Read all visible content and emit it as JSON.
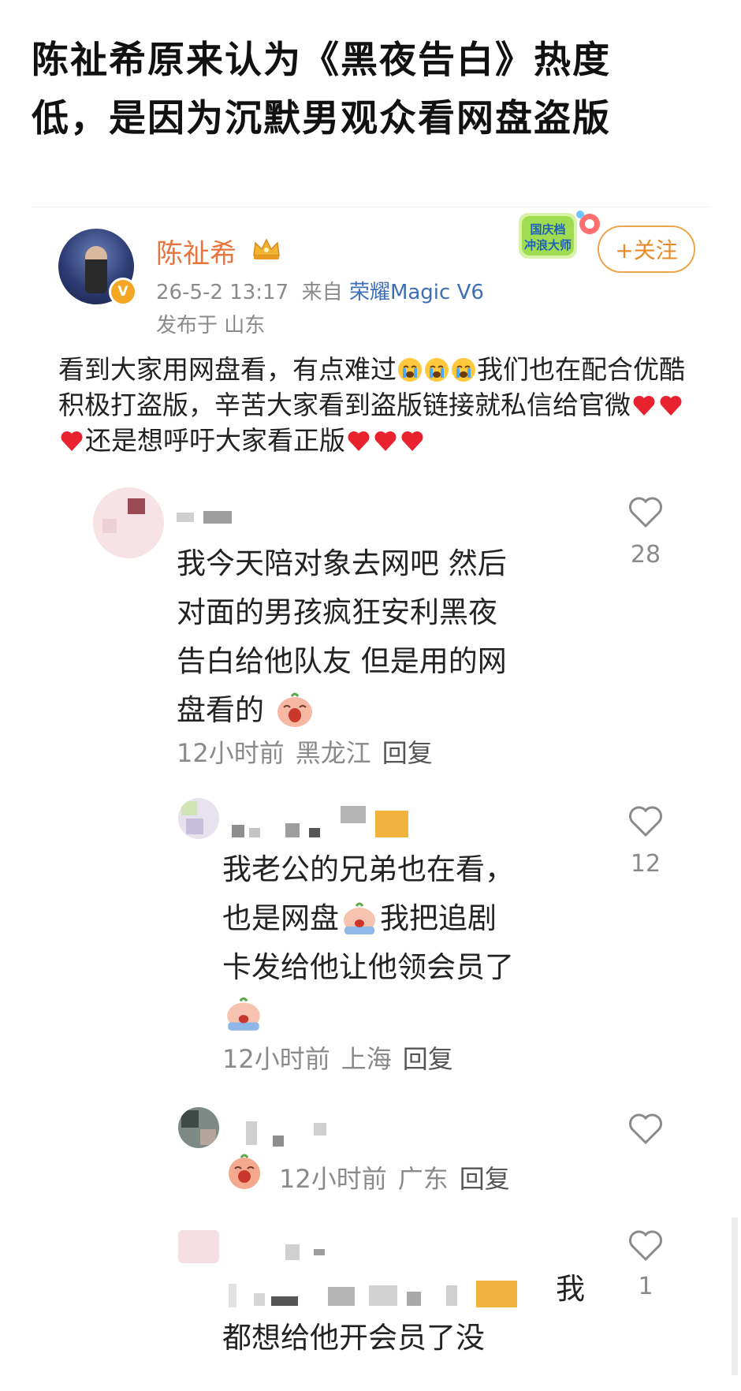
{
  "headline": {
    "line1": "陈祉希原来认为《黑夜告白》热度",
    "line2": "低，是因为沉默男观众看网盘盗版"
  },
  "post": {
    "author": "陈祉希",
    "verified_badge": "V",
    "timestamp": "26-5-2 13:17",
    "source_prefix": "来自",
    "device": "荣耀Magic V6",
    "location": "发布于 山东",
    "follow_label": "+关注",
    "promo_badge": "国庆档冲浪大师",
    "body_part1": "看到大家用网盘看，有点难过",
    "body_part2": "我们也在配合优酷积极打盗版，辛苦大家看到盗版链接就私信给官微",
    "body_part3": "还是想呼吁大家看正版",
    "emoji_cry": "crying-face-emoji",
    "emoji_heart": "red-heart-emoji"
  },
  "comments": [
    {
      "line1": "我今天陪对象去网吧 然后",
      "line2": "对面的男孩疯狂安利黑夜",
      "line3": "告白给他队友 但是用的网",
      "line4": "盘看的",
      "time": "12小时前",
      "location": "黑龙江",
      "reply": "回复",
      "likes": "28"
    },
    {
      "line1": "我老公的兄弟也在看，",
      "line2": "也是网盘",
      "line2b": "我把追剧",
      "line3": "卡发给他让他领会员了",
      "time": "12小时前",
      "location": "上海",
      "reply": "回复",
      "likes": "12"
    },
    {
      "time": "12小时前",
      "location": "广东",
      "reply": "回复",
      "likes": ""
    },
    {
      "line1": "我",
      "line2": "都想给他开会员了没",
      "likes": "1"
    }
  ]
}
